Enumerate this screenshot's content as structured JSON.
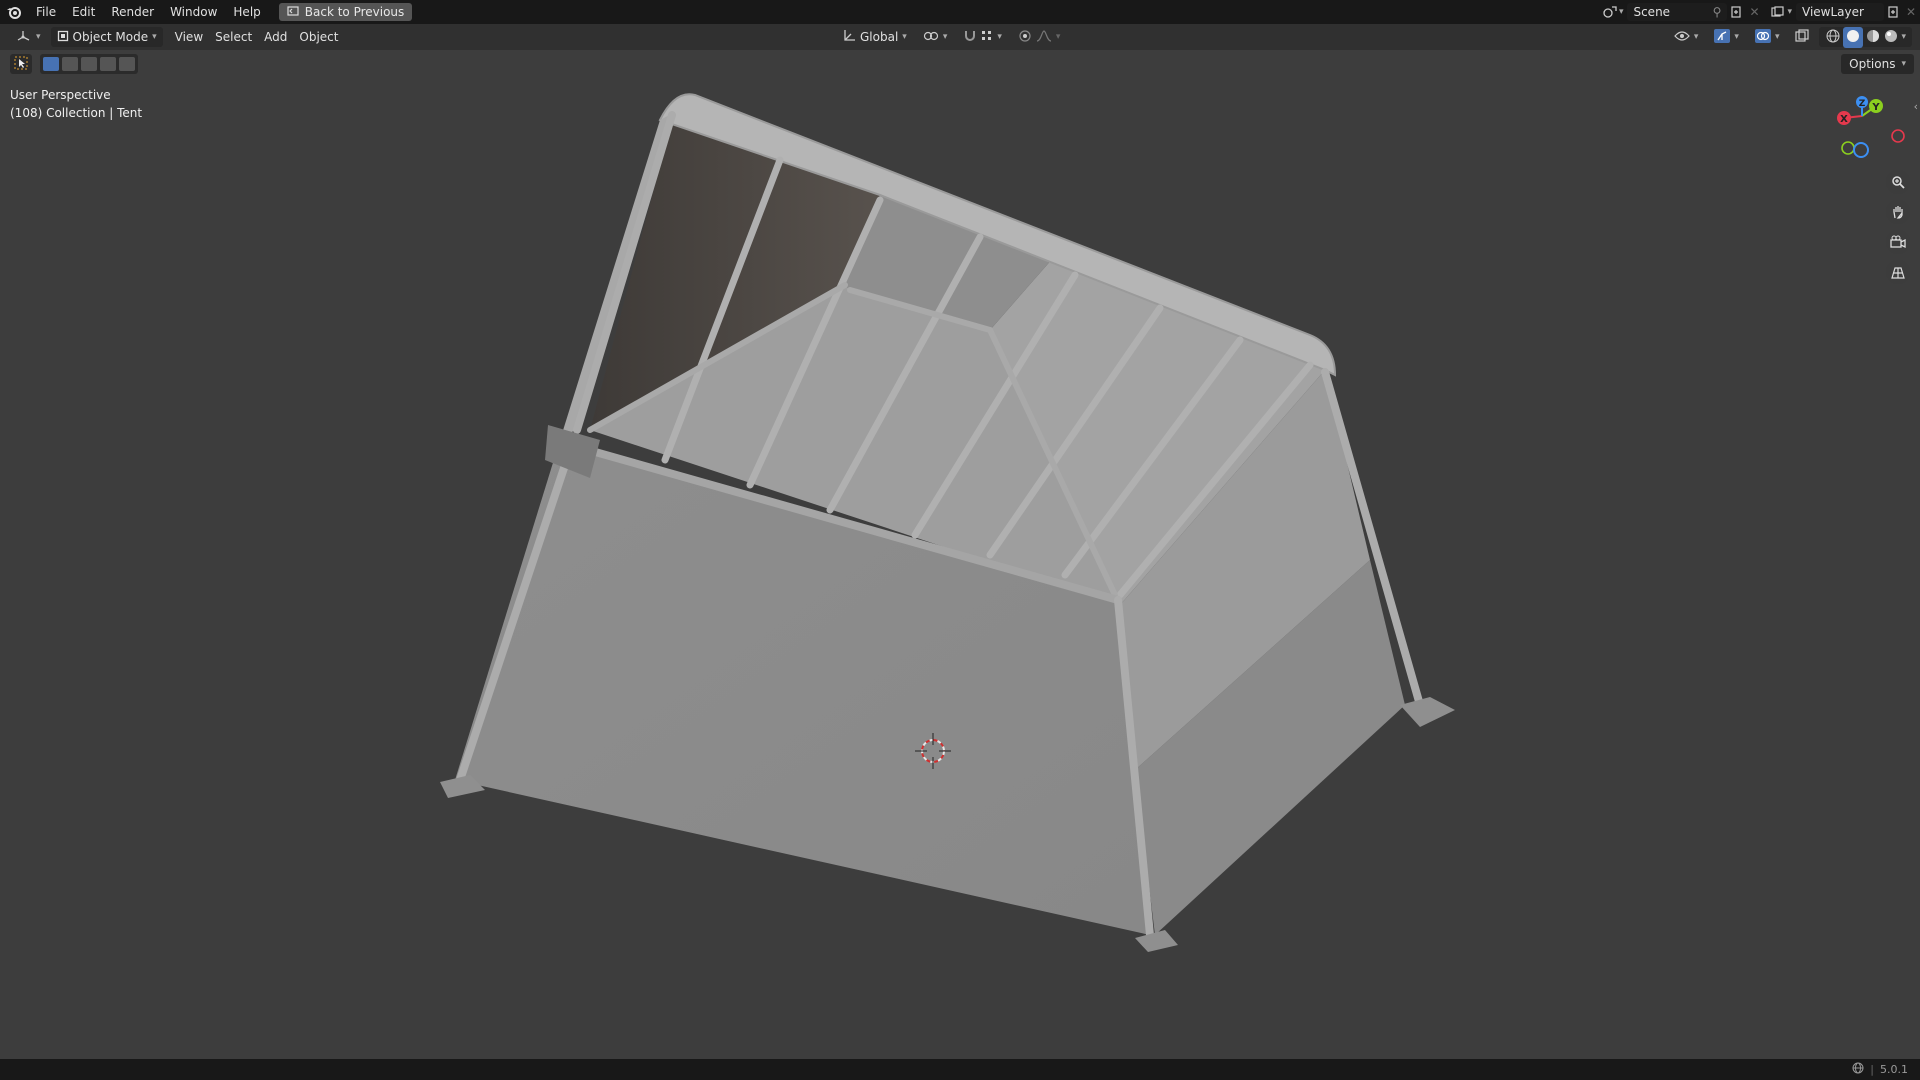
{
  "topbar": {
    "menus": [
      "File",
      "Edit",
      "Render",
      "Window",
      "Help"
    ],
    "back_button": "Back to Previous",
    "scene_name": "Scene",
    "view_layer_name": "ViewLayer"
  },
  "header": {
    "mode": "Object Mode",
    "menus": [
      "View",
      "Select",
      "Add",
      "Object"
    ],
    "orientation": "Global",
    "options": "Options"
  },
  "viewport": {
    "perspective": "User Perspective",
    "collection_info": "(108) Collection | Tent"
  },
  "gizmo": {
    "axes": {
      "x": "X",
      "y": "Y",
      "z": "Z"
    },
    "colors": {
      "x": "#e5394d",
      "y": "#8bcf1f",
      "z": "#3c8ff2"
    }
  },
  "status": {
    "version": "5.0.1"
  },
  "colors": {
    "accent": "#4772b3",
    "background": "#3d3d3d",
    "topbar": "#181818"
  }
}
